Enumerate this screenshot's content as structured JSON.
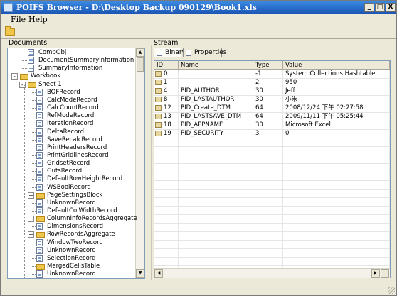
{
  "window": {
    "title": "POIFS Browser - D:\\Desktop Backup 090129\\Book1.xls",
    "minimize": "_",
    "maximize": "□",
    "close": "X"
  },
  "menu": {
    "file": "ile",
    "file_key": "F",
    "help": "elp",
    "help_key": "H"
  },
  "documents": {
    "label": "Documents",
    "tree": [
      {
        "label": "CompObj",
        "icon": "document-icon",
        "level": 1,
        "expander": ""
      },
      {
        "label": "DocumentSummaryInformation",
        "icon": "document-icon",
        "level": 1,
        "expander": ""
      },
      {
        "label": "SummaryInformation",
        "icon": "document-icon",
        "level": 1,
        "expander": ""
      },
      {
        "label": "Workbook",
        "icon": "folder-icon",
        "level": 0,
        "expander": "-"
      },
      {
        "label": "Sheet 1",
        "icon": "folder-icon",
        "level": 1,
        "expander": "-"
      },
      {
        "label": "BOFRecord",
        "icon": "document-icon",
        "level": 2,
        "expander": ""
      },
      {
        "label": "CalcModeRecord",
        "icon": "document-icon",
        "level": 2,
        "expander": ""
      },
      {
        "label": "CalcCountRecord",
        "icon": "document-icon",
        "level": 2,
        "expander": ""
      },
      {
        "label": "RefModeRecord",
        "icon": "document-icon",
        "level": 2,
        "expander": ""
      },
      {
        "label": "IterationRecord",
        "icon": "document-icon",
        "level": 2,
        "expander": ""
      },
      {
        "label": "DeltaRecord",
        "icon": "document-icon",
        "level": 2,
        "expander": ""
      },
      {
        "label": "SaveRecalcRecord",
        "icon": "document-icon",
        "level": 2,
        "expander": ""
      },
      {
        "label": "PrintHeadersRecord",
        "icon": "document-icon",
        "level": 2,
        "expander": ""
      },
      {
        "label": "PrintGridlinesRecord",
        "icon": "document-icon",
        "level": 2,
        "expander": ""
      },
      {
        "label": "GridsetRecord",
        "icon": "document-icon",
        "level": 2,
        "expander": ""
      },
      {
        "label": "GutsRecord",
        "icon": "document-icon",
        "level": 2,
        "expander": ""
      },
      {
        "label": "DefaultRowHeightRecord",
        "icon": "document-icon",
        "level": 2,
        "expander": ""
      },
      {
        "label": "WSBoolRecord",
        "icon": "document-icon",
        "level": 2,
        "expander": ""
      },
      {
        "label": "PageSettingsBlock",
        "icon": "folder-icon",
        "level": 2,
        "expander": "+"
      },
      {
        "label": "UnknownRecord",
        "icon": "document-icon",
        "level": 2,
        "expander": ""
      },
      {
        "label": "DefaultColWidthRecord",
        "icon": "document-icon",
        "level": 2,
        "expander": ""
      },
      {
        "label": "ColumnInfoRecordsAggregate",
        "icon": "folder-icon",
        "level": 2,
        "expander": "+"
      },
      {
        "label": "DimensionsRecord",
        "icon": "document-icon",
        "level": 2,
        "expander": ""
      },
      {
        "label": "RowRecordsAggregate",
        "icon": "folder-icon",
        "level": 2,
        "expander": "+"
      },
      {
        "label": "WindowTwoRecord",
        "icon": "document-icon",
        "level": 2,
        "expander": ""
      },
      {
        "label": "UnknownRecord",
        "icon": "document-icon",
        "level": 2,
        "expander": ""
      },
      {
        "label": "SelectionRecord",
        "icon": "document-icon",
        "level": 2,
        "expander": ""
      },
      {
        "label": "MergedCellsTable",
        "icon": "folder-icon",
        "level": 2,
        "expander": ""
      },
      {
        "label": "UnknownRecord",
        "icon": "document-icon",
        "level": 2,
        "expander": ""
      }
    ]
  },
  "stream": {
    "label": "Stream",
    "tabs": [
      {
        "label": "Binary",
        "active": false
      },
      {
        "label": "Properties",
        "active": true
      }
    ],
    "columns": [
      "ID",
      "Name",
      "Type",
      "Value"
    ],
    "rows": [
      {
        "id": "0",
        "name": "",
        "type": "-1",
        "value": "System.Collections.Hashtable"
      },
      {
        "id": "1",
        "name": "",
        "type": "2",
        "value": "950"
      },
      {
        "id": "4",
        "name": "PID_AUTHOR",
        "type": "30",
        "value": "Jeff"
      },
      {
        "id": "8",
        "name": "PID_LASTAUTHOR",
        "type": "30",
        "value": "小朱"
      },
      {
        "id": "12",
        "name": "PID_Create_DTM",
        "type": "64",
        "value": "2008/12/24 下午 02:27:58"
      },
      {
        "id": "13",
        "name": "PID_LASTSAVE_DTM",
        "type": "64",
        "value": "2009/11/11 下午 05:25:44"
      },
      {
        "id": "18",
        "name": "PID_APPNAME",
        "type": "30",
        "value": "Microsoft Excel"
      },
      {
        "id": "19",
        "name": "PID_SECURITY",
        "type": "3",
        "value": "0"
      }
    ]
  }
}
